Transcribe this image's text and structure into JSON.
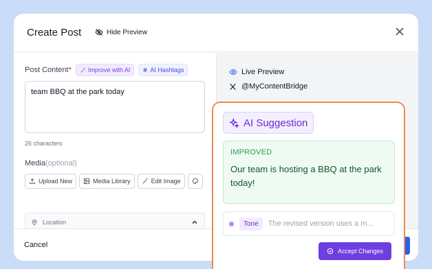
{
  "header": {
    "title": "Create Post",
    "hide_preview": "Hide Preview"
  },
  "content": {
    "label": "Post Content",
    "required_mark": "*",
    "improve_label": "Improve with AI",
    "hashtags_label": "AI Hashtags",
    "text": "team BBQ at the park today",
    "char_count": "26 characters"
  },
  "media": {
    "label": "Media",
    "optional": "(optional)",
    "buttons": [
      "Upload New",
      "Media Library",
      "Edit Image"
    ]
  },
  "location": {
    "placeholder": "Location"
  },
  "preview": {
    "live_label": "Live Preview",
    "handle": "@MyContentBridge"
  },
  "footer": {
    "cancel": "Cancel"
  },
  "ai": {
    "title": "AI Suggestion",
    "improved_tag": "IMPROVED",
    "improved_text": "Our team is hosting a BBQ at the park today!",
    "tone_label": "Tone",
    "tone_text": "The revised version uses a m...",
    "accept": "Accept Changes"
  },
  "colors": {
    "accent_purple": "#6d3fe0",
    "ai_border": "#ee8a4f",
    "success_green": "#22a05a"
  }
}
